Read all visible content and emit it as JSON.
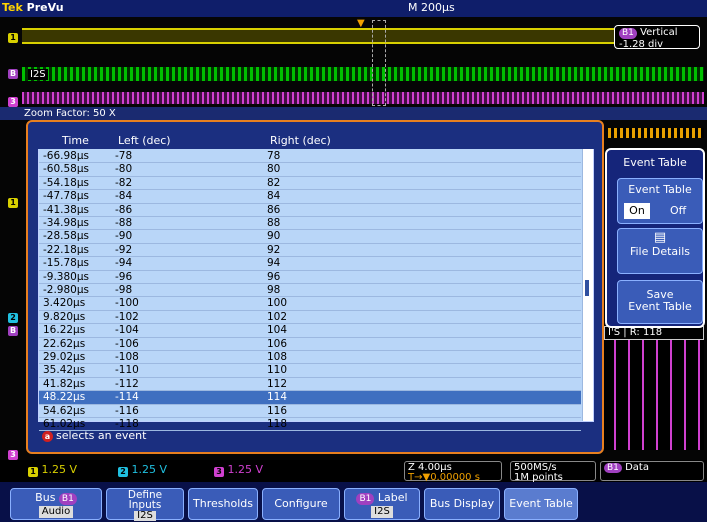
{
  "header": {
    "brand": "Tek",
    "mode": "PreVu",
    "timebase": "M 200µs"
  },
  "vertical": {
    "badge": "B1",
    "label": "Vertical",
    "value": "-1.28 div"
  },
  "bus_label": "I2S",
  "zoom": {
    "factor_text": "Zoom Factor: 50 X"
  },
  "table": {
    "columns": [
      "Time",
      "Left (dec)",
      "Right (dec)"
    ],
    "rows": [
      [
        "-66.98µs",
        "-78",
        "78"
      ],
      [
        "-60.58µs",
        "-80",
        "80"
      ],
      [
        "-54.18µs",
        "-82",
        "82"
      ],
      [
        "-47.78µs",
        "-84",
        "84"
      ],
      [
        "-41.38µs",
        "-86",
        "86"
      ],
      [
        "-34.98µs",
        "-88",
        "88"
      ],
      [
        "-28.58µs",
        "-90",
        "90"
      ],
      [
        "-22.18µs",
        "-92",
        "92"
      ],
      [
        "-15.78µs",
        "-94",
        "94"
      ],
      [
        "-9.380µs",
        "-96",
        "96"
      ],
      [
        "-2.980µs",
        "-98",
        "98"
      ],
      [
        "3.420µs",
        "-100",
        "100"
      ],
      [
        "9.820µs",
        "-102",
        "102"
      ],
      [
        "16.22µs",
        "-104",
        "104"
      ],
      [
        "22.62µs",
        "-106",
        "106"
      ],
      [
        "29.02µs",
        "-108",
        "108"
      ],
      [
        "35.42µs",
        "-110",
        "110"
      ],
      [
        "41.82µs",
        "-112",
        "112"
      ],
      [
        "48.22µs",
        "-114",
        "114"
      ],
      [
        "54.62µs",
        "-116",
        "116"
      ],
      [
        "61.02µs",
        "-118",
        "118"
      ]
    ],
    "selected_index": 18,
    "hint": "selects an event",
    "hint_badge": "a"
  },
  "side_menu": {
    "title": "Event Table",
    "toggle_label": "Event Table",
    "on": "On",
    "off": "Off",
    "file_details": "File Details",
    "save_line1": "Save",
    "save_line2": "Event Table"
  },
  "lower_labels": {
    "l1": "I'S",
    "l2": "R: 118"
  },
  "status": {
    "ch1_num": "1",
    "ch1": "1.25 V",
    "ch2_num": "2",
    "ch2": "1.25 V",
    "ch3_num": "3",
    "ch3": "1.25 V",
    "zoom": "Z 4.00µs",
    "delay": "0.00000 s",
    "rate": "500MS/s",
    "points": "1M points",
    "bus_badge": "B1",
    "bus_type": "Data"
  },
  "menu": {
    "bus_label": "Bus",
    "bus_badge": "B1",
    "bus_sub": "Audio",
    "define_l1": "Define",
    "define_l2": "Inputs",
    "define_sub": "I2S",
    "thresholds": "Thresholds",
    "configure": "Configure",
    "label_badge": "B1",
    "label": "Label",
    "label_sub": "I2S",
    "bus_display": "Bus Display",
    "event_table": "Event Table"
  },
  "colors": {
    "ch1": "#d8d000",
    "ch2": "#20c0e0",
    "ch3": "#d040d0",
    "bus": "#00c000",
    "panel_border": "#e88020"
  }
}
